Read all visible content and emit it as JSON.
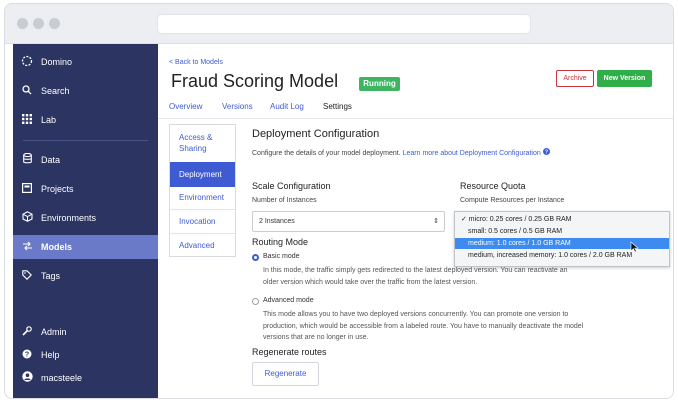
{
  "sidebar": {
    "items": [
      {
        "name": "domino",
        "label": "Domino",
        "icon": "domino-logo-icon"
      },
      {
        "name": "search",
        "label": "Search",
        "icon": "search-icon"
      },
      {
        "name": "lab",
        "label": "Lab",
        "icon": "grid-icon"
      },
      {
        "name": "data",
        "label": "Data",
        "icon": "database-icon"
      },
      {
        "name": "projects",
        "label": "Projects",
        "icon": "folder-icon"
      },
      {
        "name": "environments",
        "label": "Environments",
        "icon": "cube-icon"
      },
      {
        "name": "models",
        "label": "Models",
        "icon": "models-icon"
      },
      {
        "name": "tags",
        "label": "Tags",
        "icon": "tag-icon"
      },
      {
        "name": "admin",
        "label": "Admin",
        "icon": "wrench-icon"
      },
      {
        "name": "help",
        "label": "Help",
        "icon": "help-icon"
      },
      {
        "name": "user",
        "label": "macsteele",
        "icon": "user-icon"
      }
    ],
    "active_color": "#6a7ac8",
    "bg_color": "#2c3462"
  },
  "header": {
    "back_link": "< Back to Models",
    "title": "Fraud Scoring Model",
    "status": "Running",
    "archive_label": "Archive",
    "new_version_label": "New Version"
  },
  "tabs": [
    "Overview",
    "Versions",
    "Audit Log",
    "Settings"
  ],
  "subnav": [
    "Access &",
    "Sharing",
    "Deployment",
    "Environment",
    "Invocation",
    "Advanced"
  ],
  "deployment": {
    "title": "Deployment Configuration",
    "desc": "Configure the details of your model deployment.",
    "desc_link": "Learn more about Deployment Configuration",
    "scale_title": "Scale Configuration",
    "instances_label": "Number of Instances",
    "instances_value": "2 Instances",
    "quota_title": "Resource Quota",
    "quota_label": "Compute Resources per Instance",
    "routing_title": "Routing Mode",
    "basic_label": "Basic mode",
    "basic_desc_1": "In this mode, the traffic simply gets redirected to the latest deployed version. You can reactivate an",
    "basic_desc_2": "older version which would take over the traffic from the latest version.",
    "advanced_label": "Advanced mode",
    "advanced_desc_1": "This mode allows you to have two deployed versions concurrently. You can promote one version to",
    "advanced_desc_2": "production, which would be accessible from a labeled route. You have to manually deactivate the model",
    "advanced_desc_3": "versions that are no longer in use.",
    "regen_title": "Regenerate routes",
    "regen_button": "Regenerate"
  },
  "quota_options": [
    "✓ micro: 0.25 cores / 0.25 GB RAM",
    "small: 0.5 cores / 0.5 GB RAM",
    "medium: 1.0 cores / 1.0 GB RAM",
    "medium, increased memory: 1.0 cores / 2.0 GB RAM"
  ],
  "quota_highlighted_index": 2
}
